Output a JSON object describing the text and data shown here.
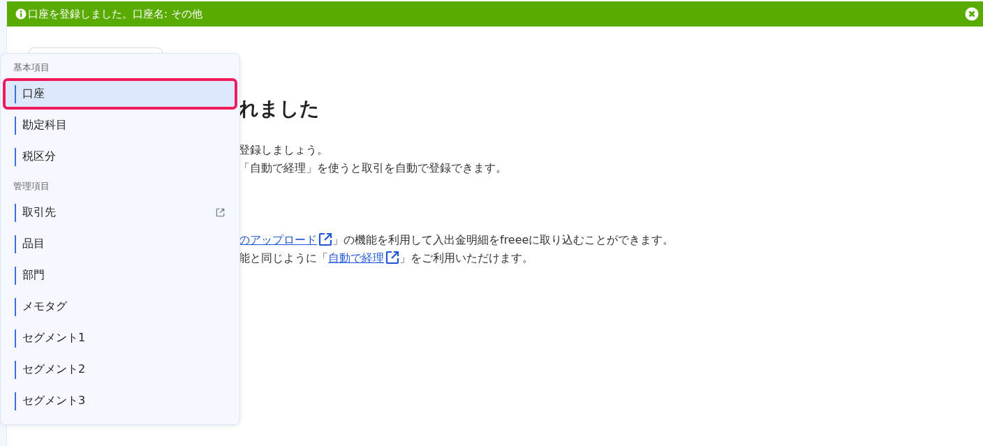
{
  "banner": {
    "message": "口座を登録しました。口座名: その他"
  },
  "menu": {
    "sections": [
      {
        "heading": "基本項目",
        "items": [
          {
            "label": "口座",
            "selected": true,
            "highlighted": true,
            "external": false
          },
          {
            "label": "勘定科目",
            "selected": false,
            "highlighted": false,
            "external": false
          },
          {
            "label": "税区分",
            "selected": false,
            "highlighted": false,
            "external": false
          }
        ]
      },
      {
        "heading": "管理項目",
        "items": [
          {
            "label": "取引先",
            "selected": false,
            "highlighted": false,
            "external": true
          },
          {
            "label": "品目",
            "selected": false,
            "highlighted": false,
            "external": false
          },
          {
            "label": "部門",
            "selected": false,
            "highlighted": false,
            "external": false
          },
          {
            "label": "メモタグ",
            "selected": false,
            "highlighted": false,
            "external": false
          },
          {
            "label": "セグメント1",
            "selected": false,
            "highlighted": false,
            "external": false
          },
          {
            "label": "セグメント2",
            "selected": false,
            "highlighted": false,
            "external": false
          },
          {
            "label": "セグメント3",
            "selected": false,
            "highlighted": false,
            "external": false
          }
        ]
      }
    ]
  },
  "content": {
    "heading": "れました",
    "lines": [
      {
        "parts": [
          {
            "kind": "text",
            "text": "登録しましょう。"
          }
        ]
      },
      {
        "parts": [
          {
            "kind": "text",
            "text": "「自動で経理」を使うと取引を自動で登録できます。"
          }
        ]
      }
    ],
    "link_lines": [
      {
        "parts": [
          {
            "kind": "link",
            "text": "のアップロード"
          },
          {
            "kind": "text",
            "text": "」の機能を利用して入出金明細をfreeeに取り込むことができます。"
          }
        ]
      },
      {
        "parts": [
          {
            "kind": "text",
            "text": "能と同じように「"
          },
          {
            "kind": "link",
            "text": "自動で経理"
          },
          {
            "kind": "text",
            "text": "」をご利用いただけます。"
          }
        ]
      }
    ]
  }
}
